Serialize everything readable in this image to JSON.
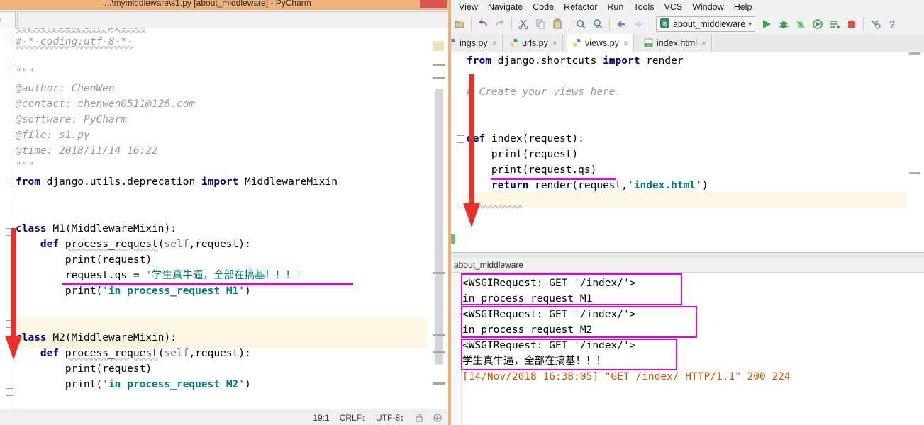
{
  "left_window": {
    "title": "...\\mymiddleware\\s1.py [about_middleware] - PyCharm",
    "tab_label": "y",
    "tab_close": "×",
    "code_lines": [
      "#!/usr/bin/env python",
      "#-*-coding:utf-8-*-",
      "",
      "\"\"\"",
      "@author: ChenWen",
      "@contact: chenwen0511@126.com",
      "@software: PyCharm",
      "@file: s1.py",
      "@time: 2018/11/14 16:22",
      "\"\"\"",
      "from django.utils.deprecation import MiddlewareMixin",
      "",
      "",
      "class M1(MiddlewareMixin):",
      "    def process_request(self,request):",
      "        print(request)",
      "        request.qs = '学生真牛逼，全部在搞基！！！'",
      "        print('in process_request M1')",
      "",
      "",
      "class M2(MiddlewareMixin):",
      "    def process_request(self,request):",
      "        print(request)",
      "        print('in process_request M2')"
    ],
    "status_bar": {
      "caret": "19:1",
      "line_separator": "CRLF",
      "encoding": "UTF-8",
      "lock_icon": "lock-icon",
      "inspection_icon": "inspection-icon"
    }
  },
  "right_window": {
    "menu": [
      {
        "label": "View",
        "mnemonic": "V"
      },
      {
        "label": "Navigate",
        "mnemonic": "N"
      },
      {
        "label": "Code",
        "mnemonic": "C"
      },
      {
        "label": "Refactor",
        "mnemonic": "R"
      },
      {
        "label": "Run",
        "mnemonic": "u"
      },
      {
        "label": "Tools",
        "mnemonic": "T"
      },
      {
        "label": "VCS",
        "mnemonic": "S"
      },
      {
        "label": "Window",
        "mnemonic": "W"
      },
      {
        "label": "Help",
        "mnemonic": "H"
      }
    ],
    "toolbar": {
      "icons": [
        "open-icon",
        "undo-icon",
        "redo-icon",
        "cut-icon",
        "copy-icon",
        "paste-icon",
        "find-icon",
        "replace-icon",
        "back-icon",
        "forward-icon"
      ],
      "run_config": {
        "icon": "django-icon",
        "label": "about_middleware",
        "chevron": "∨"
      },
      "right_icons": [
        "run-icon",
        "debug-icon",
        "coverage-icon",
        "profile-icon",
        "attach-icon",
        "stop-icon",
        "settings-icon",
        "help-icon"
      ]
    },
    "tabs": [
      {
        "label": "ings.py",
        "icon": "python-file-icon",
        "active": false,
        "close": "×"
      },
      {
        "label": "urls.py",
        "icon": "python-file-icon",
        "active": false,
        "close": "×"
      },
      {
        "label": "views.py",
        "icon": "python-file-icon",
        "active": true,
        "close": "×"
      },
      {
        "label": "index.html",
        "icon": "html-file-icon",
        "active": false,
        "close": "×"
      }
    ],
    "code_lines": [
      "from django.shortcuts import render",
      "",
      "# Create your views here.",
      "",
      "",
      "def index(request):",
      "    print(request)",
      "    print(request.qs)",
      "    return render(request,'index.html')"
    ],
    "console": {
      "header": "about_middleware",
      "lines": [
        "<WSGIRequest: GET '/index/'>",
        "in process request M1",
        "<WSGIRequest: GET '/index/'>",
        "in process request M2",
        "<WSGIRequest: GET '/index/'>",
        "学生真牛逼，全部在搞基！！！",
        "[14/Nov/2018 16:38:05] \"GET /index/ HTTP/1.1\" 200 224"
      ]
    }
  },
  "annotations": {
    "highlight_color": "#e000e0",
    "arrow_color": "#e8302a",
    "notes": [
      "magenta underline on request.qs assignment in M1",
      "magenta underline on print(request.qs) in views.py",
      "magenta boxes around three console request blocks",
      "red down arrow from class M1 through class M2 in s1.py",
      "red down arrow from def index in views.py"
    ]
  }
}
